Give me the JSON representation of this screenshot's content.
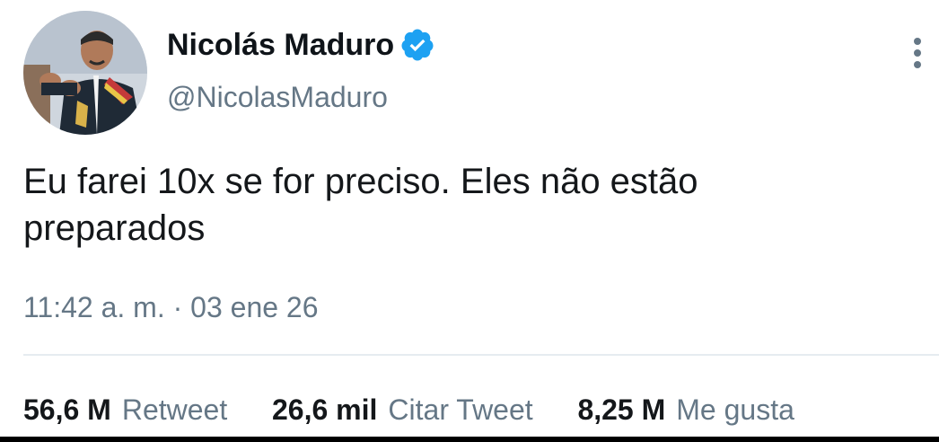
{
  "author": {
    "display_name": "Nicolás Maduro",
    "handle": "@NicolasMaduro",
    "verified": true
  },
  "tweet": {
    "text_line1": "Eu farei 10x se for preciso. Eles não estão",
    "text_line2": "preparados",
    "timestamp": "11:42 a. m. · 03 ene 26"
  },
  "stats": {
    "retweets_count": "56,6 M",
    "retweets_label": "Retweet",
    "quotes_count": "26,6 mil",
    "quotes_label": "Citar Tweet",
    "likes_count": "8,25 M",
    "likes_label": "Me gusta"
  },
  "icons": {
    "verified": "verified-badge-icon",
    "more": "more-vertical-icon"
  },
  "colors": {
    "verified_blue": "#1da1f2",
    "secondary_text": "#657786",
    "primary_text": "#14171a"
  }
}
